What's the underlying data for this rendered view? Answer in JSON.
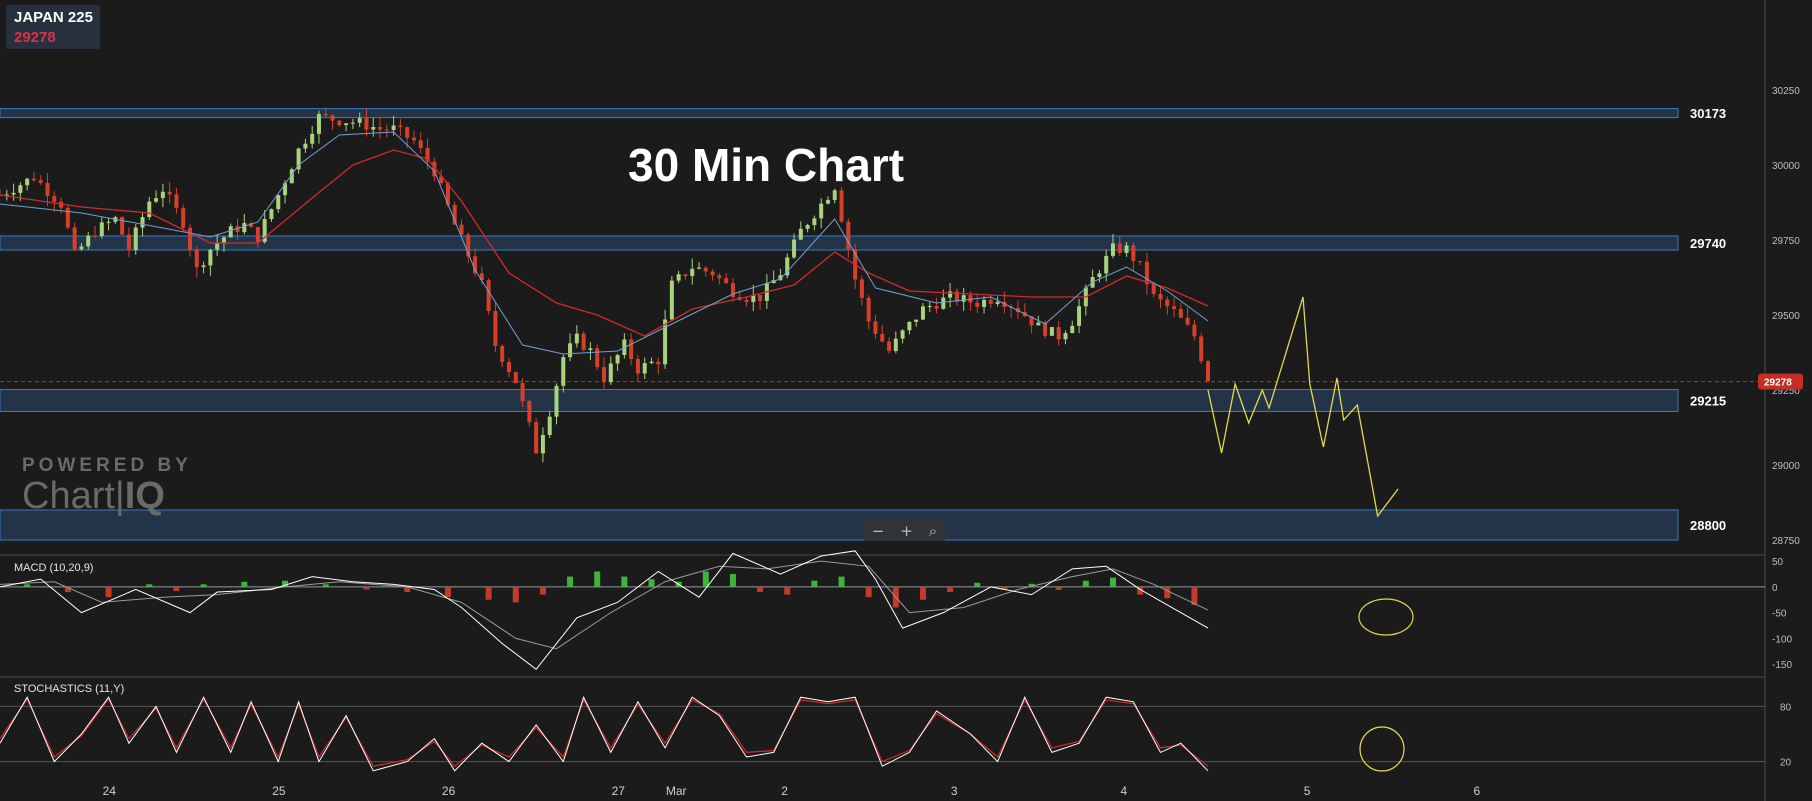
{
  "symbol": {
    "name": "JAPAN 225",
    "price": "29278"
  },
  "title": "30 Min Chart",
  "watermark": {
    "line1": "POWERED BY",
    "line2a": "Chart",
    "line2b": "IQ"
  },
  "zoom": {
    "minus": "−",
    "plus": "+",
    "reset": "⌕"
  },
  "colors": {
    "bg": "#1b1b1b",
    "up": "#a8d37c",
    "down": "#d6402a",
    "ma_fast": "#6fa0d8",
    "ma_slow": "#d12a2a",
    "zone": "#3a78c2",
    "projection": "#e5d84a",
    "price_tag": "#c42e24"
  },
  "chart_data": [
    {
      "type": "candlestick",
      "ylim": [
        28700,
        30350
      ],
      "x_ticks": [
        "24",
        "25",
        "26",
        "27",
        "Mar",
        "2",
        "3",
        "4",
        "5",
        "6"
      ],
      "y_ticks": [
        "30250",
        "30000",
        "29750",
        "29500",
        "29250",
        "29000",
        "28750"
      ],
      "last_price_label": "29278",
      "levels": [
        {
          "label": "30173",
          "value": 30173
        },
        {
          "label": "29740",
          "value": 29740
        },
        {
          "label": "29215",
          "value": 29215
        },
        {
          "label": "28800",
          "value": 28800
        }
      ],
      "close_path": [
        [
          0,
          29900
        ],
        [
          5,
          29960
        ],
        [
          9,
          29870
        ],
        [
          11,
          29700
        ],
        [
          14,
          29780
        ],
        [
          17,
          29820
        ],
        [
          19,
          29720
        ],
        [
          22,
          29880
        ],
        [
          24,
          29920
        ],
        [
          27,
          29810
        ],
        [
          29,
          29650
        ],
        [
          31,
          29720
        ],
        [
          34,
          29780
        ],
        [
          36,
          29800
        ],
        [
          38,
          29760
        ],
        [
          41,
          29900
        ],
        [
          44,
          30050
        ],
        [
          47,
          30160
        ],
        [
          50,
          30150
        ],
        [
          53,
          30140
        ],
        [
          56,
          30120
        ],
        [
          58,
          30120
        ],
        [
          61,
          30080
        ],
        [
          64,
          29980
        ],
        [
          67,
          29800
        ],
        [
          71,
          29600
        ],
        [
          73,
          29400
        ],
        [
          76,
          29280
        ],
        [
          79,
          29050
        ],
        [
          81,
          29180
        ],
        [
          83,
          29360
        ],
        [
          85,
          29420
        ],
        [
          87,
          29380
        ],
        [
          89,
          29290
        ],
        [
          92,
          29400
        ],
        [
          94,
          29320
        ],
        [
          97,
          29350
        ],
        [
          99,
          29600
        ],
        [
          102,
          29660
        ],
        [
          105,
          29640
        ],
        [
          108,
          29580
        ],
        [
          110,
          29560
        ],
        [
          112,
          29560
        ],
        [
          115,
          29640
        ],
        [
          118,
          29780
        ],
        [
          121,
          29870
        ],
        [
          123,
          29930
        ],
        [
          126,
          29620
        ],
        [
          128,
          29480
        ],
        [
          131,
          29380
        ],
        [
          133,
          29440
        ],
        [
          136,
          29520
        ],
        [
          140,
          29560
        ],
        [
          144,
          29540
        ],
        [
          147,
          29560
        ],
        [
          150,
          29520
        ],
        [
          153,
          29460
        ],
        [
          156,
          29430
        ],
        [
          158,
          29480
        ],
        [
          161,
          29620
        ],
        [
          164,
          29720
        ],
        [
          166,
          29720
        ],
        [
          168,
          29660
        ],
        [
          170,
          29560
        ],
        [
          173,
          29510
        ],
        [
          176,
          29430
        ],
        [
          178,
          29290
        ]
      ],
      "ma_fast": [
        [
          0,
          29870
        ],
        [
          12,
          29840
        ],
        [
          24,
          29790
        ],
        [
          31,
          29760
        ],
        [
          38,
          29810
        ],
        [
          44,
          30000
        ],
        [
          50,
          30100
        ],
        [
          58,
          30110
        ],
        [
          64,
          29980
        ],
        [
          70,
          29650
        ],
        [
          77,
          29400
        ],
        [
          83,
          29370
        ],
        [
          91,
          29380
        ],
        [
          99,
          29470
        ],
        [
          108,
          29570
        ],
        [
          115,
          29620
        ],
        [
          123,
          29820
        ],
        [
          129,
          29590
        ],
        [
          138,
          29540
        ],
        [
          146,
          29560
        ],
        [
          154,
          29470
        ],
        [
          161,
          29610
        ],
        [
          166,
          29660
        ],
        [
          172,
          29580
        ],
        [
          178,
          29480
        ]
      ],
      "ma_slow": [
        [
          0,
          29900
        ],
        [
          12,
          29860
        ],
        [
          22,
          29840
        ],
        [
          31,
          29740
        ],
        [
          38,
          29740
        ],
        [
          46,
          29890
        ],
        [
          52,
          30000
        ],
        [
          58,
          30050
        ],
        [
          63,
          30020
        ],
        [
          68,
          29880
        ],
        [
          75,
          29640
        ],
        [
          82,
          29540
        ],
        [
          88,
          29500
        ],
        [
          95,
          29430
        ],
        [
          102,
          29520
        ],
        [
          110,
          29560
        ],
        [
          117,
          29600
        ],
        [
          123,
          29710
        ],
        [
          128,
          29640
        ],
        [
          134,
          29580
        ],
        [
          143,
          29570
        ],
        [
          152,
          29560
        ],
        [
          160,
          29560
        ],
        [
          166,
          29630
        ],
        [
          172,
          29590
        ],
        [
          178,
          29530
        ]
      ],
      "projection": [
        [
          178,
          29250
        ],
        [
          180,
          29040
        ],
        [
          182,
          29270
        ],
        [
          184,
          29140
        ],
        [
          186,
          29250
        ],
        [
          187,
          29190
        ],
        [
          192,
          29560
        ],
        [
          193,
          29270
        ],
        [
          195,
          29060
        ],
        [
          197,
          29290
        ],
        [
          198,
          29150
        ],
        [
          200,
          29200
        ],
        [
          203,
          28830
        ],
        [
          206,
          28920
        ]
      ]
    },
    {
      "type": "line",
      "title": "MACD (10,20,9)",
      "ylim": [
        -175,
        60
      ],
      "y_ticks": [
        "50",
        "0",
        "-50",
        "-100",
        "-150"
      ],
      "macd": [
        [
          0,
          0
        ],
        [
          6,
          15
        ],
        [
          12,
          -50
        ],
        [
          20,
          -5
        ],
        [
          28,
          -50
        ],
        [
          32,
          -10
        ],
        [
          40,
          -5
        ],
        [
          46,
          20
        ],
        [
          52,
          10
        ],
        [
          58,
          5
        ],
        [
          64,
          -5
        ],
        [
          68,
          -40
        ],
        [
          74,
          -110
        ],
        [
          79,
          -160
        ],
        [
          85,
          -60
        ],
        [
          91,
          -30
        ],
        [
          97,
          30
        ],
        [
          103,
          -20
        ],
        [
          108,
          65
        ],
        [
          115,
          25
        ],
        [
          121,
          60
        ],
        [
          126,
          70
        ],
        [
          129,
          15
        ],
        [
          133,
          -80
        ],
        [
          139,
          -50
        ],
        [
          146,
          0
        ],
        [
          152,
          -15
        ],
        [
          158,
          35
        ],
        [
          163,
          40
        ],
        [
          168,
          -5
        ],
        [
          172,
          -35
        ],
        [
          178,
          -80
        ]
      ],
      "signal": [
        [
          0,
          5
        ],
        [
          8,
          10
        ],
        [
          15,
          -30
        ],
        [
          24,
          -20
        ],
        [
          32,
          -15
        ],
        [
          42,
          0
        ],
        [
          50,
          10
        ],
        [
          60,
          0
        ],
        [
          68,
          -30
        ],
        [
          76,
          -100
        ],
        [
          82,
          -120
        ],
        [
          90,
          -50
        ],
        [
          98,
          10
        ],
        [
          106,
          40
        ],
        [
          113,
          35
        ],
        [
          121,
          50
        ],
        [
          128,
          40
        ],
        [
          134,
          -50
        ],
        [
          142,
          -40
        ],
        [
          150,
          -5
        ],
        [
          158,
          20
        ],
        [
          164,
          35
        ],
        [
          170,
          5
        ],
        [
          178,
          -45
        ]
      ],
      "histogram": [
        [
          4,
          5
        ],
        [
          10,
          -10
        ],
        [
          16,
          -20
        ],
        [
          22,
          5
        ],
        [
          26,
          -8
        ],
        [
          30,
          5
        ],
        [
          36,
          10
        ],
        [
          42,
          12
        ],
        [
          48,
          5
        ],
        [
          54,
          -5
        ],
        [
          60,
          -10
        ],
        [
          66,
          -20
        ],
        [
          72,
          -25
        ],
        [
          76,
          -30
        ],
        [
          80,
          -15
        ],
        [
          84,
          20
        ],
        [
          88,
          30
        ],
        [
          92,
          20
        ],
        [
          96,
          15
        ],
        [
          100,
          10
        ],
        [
          104,
          30
        ],
        [
          108,
          25
        ],
        [
          112,
          -10
        ],
        [
          116,
          -15
        ],
        [
          120,
          12
        ],
        [
          124,
          20
        ],
        [
          128,
          -20
        ],
        [
          132,
          -40
        ],
        [
          136,
          -25
        ],
        [
          140,
          -10
        ],
        [
          144,
          8
        ],
        [
          148,
          -6
        ],
        [
          152,
          6
        ],
        [
          156,
          -6
        ],
        [
          160,
          12
        ],
        [
          164,
          18
        ],
        [
          168,
          -15
        ],
        [
          172,
          -22
        ],
        [
          176,
          -35
        ]
      ]
    },
    {
      "type": "line",
      "title": "STOCHASTICS (11,Y)",
      "ylim": [
        0,
        100
      ],
      "y_ticks": [
        "80",
        "20"
      ],
      "k": [
        [
          0,
          40
        ],
        [
          4,
          90
        ],
        [
          8,
          20
        ],
        [
          12,
          50
        ],
        [
          16,
          90
        ],
        [
          19,
          40
        ],
        [
          23,
          80
        ],
        [
          26,
          30
        ],
        [
          30,
          90
        ],
        [
          34,
          30
        ],
        [
          37,
          85
        ],
        [
          41,
          20
        ],
        [
          44,
          85
        ],
        [
          47,
          20
        ],
        [
          51,
          70
        ],
        [
          55,
          10
        ],
        [
          60,
          20
        ],
        [
          64,
          45
        ],
        [
          67,
          10
        ],
        [
          71,
          40
        ],
        [
          75,
          20
        ],
        [
          79,
          60
        ],
        [
          83,
          20
        ],
        [
          86,
          90
        ],
        [
          90,
          30
        ],
        [
          94,
          85
        ],
        [
          98,
          35
        ],
        [
          102,
          90
        ],
        [
          106,
          70
        ],
        [
          110,
          25
        ],
        [
          114,
          30
        ],
        [
          118,
          90
        ],
        [
          122,
          85
        ],
        [
          126,
          90
        ],
        [
          130,
          15
        ],
        [
          134,
          30
        ],
        [
          138,
          75
        ],
        [
          143,
          50
        ],
        [
          147,
          20
        ],
        [
          151,
          90
        ],
        [
          155,
          30
        ],
        [
          159,
          40
        ],
        [
          163,
          90
        ],
        [
          167,
          85
        ],
        [
          171,
          30
        ],
        [
          174,
          40
        ],
        [
          178,
          10
        ]
      ],
      "d": [
        [
          0,
          45
        ],
        [
          4,
          88
        ],
        [
          8,
          25
        ],
        [
          12,
          48
        ],
        [
          16,
          88
        ],
        [
          19,
          45
        ],
        [
          23,
          78
        ],
        [
          26,
          35
        ],
        [
          30,
          88
        ],
        [
          34,
          35
        ],
        [
          37,
          82
        ],
        [
          41,
          25
        ],
        [
          44,
          82
        ],
        [
          47,
          25
        ],
        [
          51,
          68
        ],
        [
          55,
          15
        ],
        [
          60,
          22
        ],
        [
          64,
          42
        ],
        [
          67,
          15
        ],
        [
          71,
          38
        ],
        [
          75,
          25
        ],
        [
          79,
          57
        ],
        [
          83,
          25
        ],
        [
          86,
          87
        ],
        [
          90,
          35
        ],
        [
          94,
          82
        ],
        [
          98,
          40
        ],
        [
          102,
          87
        ],
        [
          106,
          72
        ],
        [
          110,
          30
        ],
        [
          114,
          32
        ],
        [
          118,
          87
        ],
        [
          122,
          83
        ],
        [
          126,
          87
        ],
        [
          130,
          20
        ],
        [
          134,
          32
        ],
        [
          138,
          72
        ],
        [
          143,
          50
        ],
        [
          147,
          25
        ],
        [
          151,
          87
        ],
        [
          155,
          35
        ],
        [
          159,
          42
        ],
        [
          163,
          87
        ],
        [
          167,
          83
        ],
        [
          171,
          35
        ],
        [
          174,
          38
        ],
        [
          178,
          15
        ]
      ]
    }
  ]
}
